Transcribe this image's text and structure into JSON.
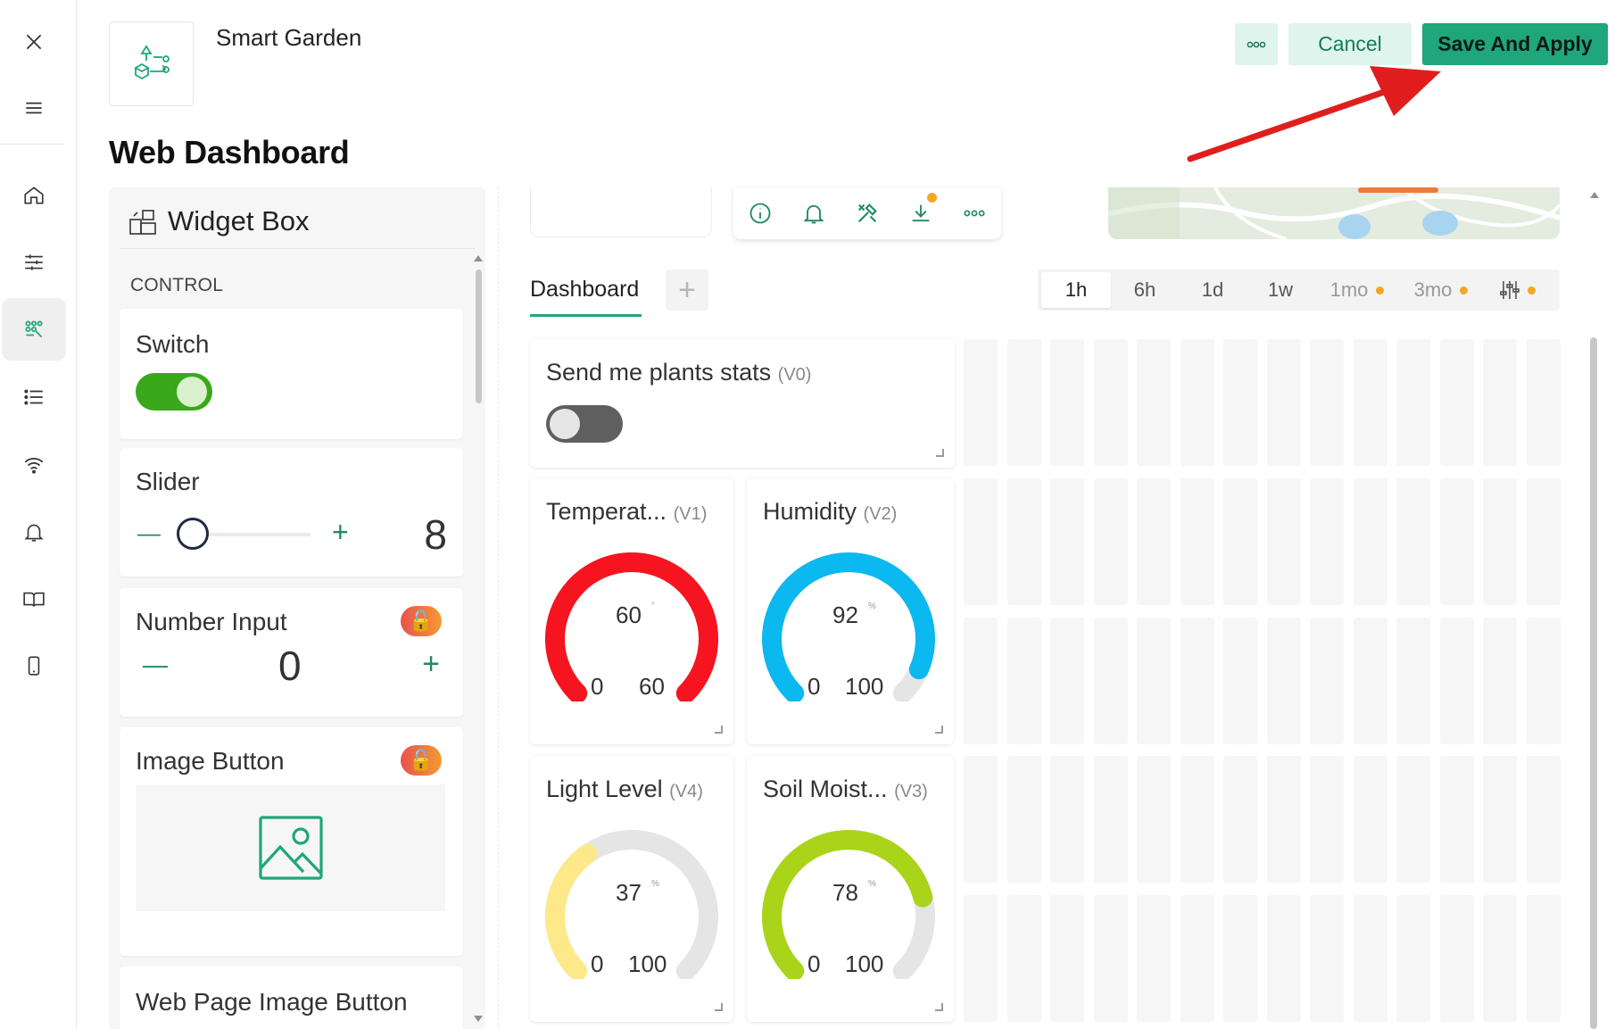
{
  "app": {
    "title": "Smart Garden",
    "page_title": "Web Dashboard"
  },
  "actions": {
    "more_label": "•••",
    "cancel_label": "Cancel",
    "save_label": "Save And Apply"
  },
  "rail": {
    "items": [
      {
        "icon": "close-icon"
      },
      {
        "icon": "menu-icon"
      },
      {
        "icon": "home-icon"
      },
      {
        "icon": "sliders-icon"
      },
      {
        "icon": "datastreams-icon",
        "active": true
      },
      {
        "icon": "list-icon"
      },
      {
        "icon": "wifi-icon"
      },
      {
        "icon": "bell-icon"
      },
      {
        "icon": "book-icon"
      },
      {
        "icon": "mobile-icon"
      }
    ]
  },
  "widget_box": {
    "title": "Widget Box",
    "section": "CONTROL",
    "widgets": [
      {
        "name": "Switch"
      },
      {
        "name": "Slider",
        "value": "8",
        "minus": "—",
        "plus": "+"
      },
      {
        "name": "Number Input",
        "value": "0",
        "minus": "—",
        "plus": "+",
        "locked": true
      },
      {
        "name": "Image Button",
        "locked": true
      },
      {
        "name": "Web Page Image Button"
      }
    ]
  },
  "toolbar": {
    "icons": [
      "info-icon",
      "bell-icon",
      "tools-icon",
      "download-icon",
      "more-icon"
    ]
  },
  "tabs": {
    "items": [
      {
        "label": "Dashboard"
      }
    ],
    "add_label": "+"
  },
  "time_range": {
    "items": [
      {
        "label": "1h",
        "active": true
      },
      {
        "label": "6h"
      },
      {
        "label": "1d"
      },
      {
        "label": "1w"
      },
      {
        "label": "1mo",
        "badge": true
      },
      {
        "label": "3mo",
        "badge": true
      },
      {
        "label": "",
        "icon": "filter-sliders-icon",
        "badge": true
      }
    ]
  },
  "dashboard": {
    "switch_widget": {
      "title": "Send me plants stats",
      "pin": "(V0)"
    },
    "gauges": [
      {
        "title": "Temperat...",
        "pin": "(V1)",
        "value": "60",
        "unit": "°",
        "min": "0",
        "max": "60",
        "fraction": 1.0,
        "color": "#f5141f"
      },
      {
        "title": "Humidity",
        "pin": "(V2)",
        "value": "92",
        "unit": "%",
        "min": "0",
        "max": "100",
        "fraction": 0.92,
        "color": "#0bb8ef"
      },
      {
        "title": "Light Level",
        "pin": "(V4)",
        "value": "37",
        "unit": "%",
        "min": "0",
        "max": "100",
        "fraction": 0.37,
        "color": "#fde98a"
      },
      {
        "title": "Soil Moist...",
        "pin": "(V3)",
        "value": "78",
        "unit": "%",
        "min": "0",
        "max": "100",
        "fraction": 0.78,
        "color": "#a9d419"
      }
    ]
  },
  "colors": {
    "accent": "#1fa67a",
    "accent_light": "#def4ec",
    "switch_on": "#3aa81a",
    "switch_off": "#5f5f5f",
    "annotation_arrow": "#e01e1e"
  }
}
